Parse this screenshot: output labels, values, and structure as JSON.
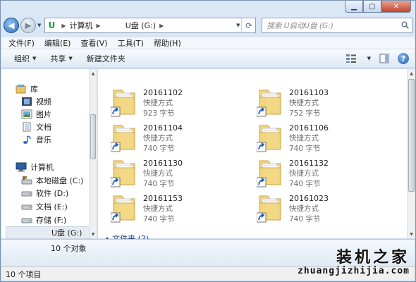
{
  "address": {
    "segments": [
      "计算机",
      "U盘 (G:)"
    ]
  },
  "search": {
    "placeholder": "搜索 U启动U盘 (G:)"
  },
  "menu": [
    "文件(F)",
    "编辑(E)",
    "查看(V)",
    "工具(T)",
    "帮助(H)"
  ],
  "toolbar": {
    "organize": "组织",
    "share": "共享",
    "new_folder": "新建文件夹"
  },
  "navpane": {
    "library": "库",
    "library_items": [
      "视频",
      "图片",
      "文档",
      "音乐"
    ],
    "computer": "计算机",
    "drives": [
      "本地磁盘 (C:)",
      "软件 (D:)",
      "文档 (E:)",
      "存储 (F:)",
      "U盘 (G:)"
    ]
  },
  "files": [
    {
      "name": "20161102",
      "type": "快捷方式",
      "size": "923 字节"
    },
    {
      "name": "20161103",
      "type": "快捷方式",
      "size": "752 字节"
    },
    {
      "name": "20161104",
      "type": "快捷方式",
      "size": "740 字节"
    },
    {
      "name": "20161106",
      "type": "快捷方式",
      "size": "740 字节"
    },
    {
      "name": "20161130",
      "type": "快捷方式",
      "size": "740 字节"
    },
    {
      "name": "20161132",
      "type": "快捷方式",
      "size": "740 字节"
    },
    {
      "name": "20161153",
      "type": "快捷方式",
      "size": "740 字节"
    },
    {
      "name": "20161023",
      "type": "快捷方式",
      "size": "740 字节"
    }
  ],
  "group_header": "文件夹 (2)",
  "details": {
    "count": "10 个对象"
  },
  "status": {
    "items": "10 个项目"
  },
  "watermark": {
    "cn": "装机之家",
    "url": "zhuangjizhijia.com"
  },
  "colors": {
    "folder": "#f2d57a",
    "selection": "#e4ebf3",
    "accent": "#2d6fb8"
  }
}
